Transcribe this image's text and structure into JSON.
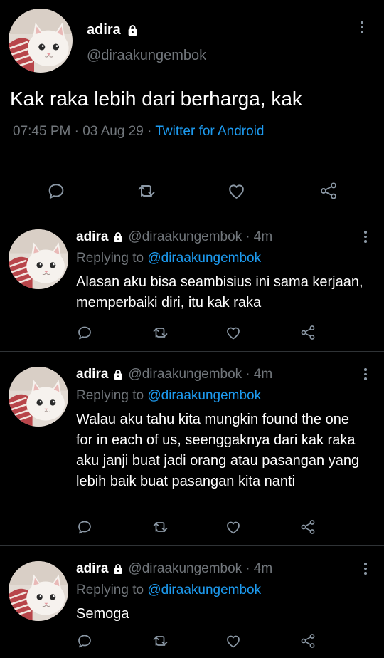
{
  "main_tweet": {
    "display_name": "adira",
    "handle": "@diraakungembok",
    "text": "Kak raka lebih dari berharga, kak",
    "time": "07:45 PM",
    "date": "03 Aug 29",
    "separator": "·",
    "source": "Twitter for Android"
  },
  "replies": [
    {
      "display_name": "adira",
      "handle": "@diraakungembok",
      "age": "· 4m",
      "replying_prefix": "Replying to ",
      "replying_handle": "@diraakungembok",
      "text": "Alasan aku bisa seambisius ini sama kerjaan, memperbaiki diri, itu kak raka"
    },
    {
      "display_name": "adira",
      "handle": "@diraakungembok",
      "age": "· 4m",
      "replying_prefix": "Replying to ",
      "replying_handle": "@diraakungembok",
      "text": "Walau aku tahu kita mungkin found the one for in each of us, seenggaknya dari kak raka aku janji buat jadi orang atau pasangan yang lebih baik buat pasangan kita nanti"
    },
    {
      "display_name": "adira",
      "handle": "@diraakungembok",
      "age": "· 4m",
      "replying_prefix": "Replying to ",
      "replying_handle": "@diraakungembok",
      "text": "Semoga"
    }
  ],
  "icons": [
    "lock-icon",
    "more-options-icon",
    "reply-icon",
    "retweet-icon",
    "like-icon",
    "share-icon"
  ],
  "colors": {
    "background": "#000000",
    "text": "#e7e9ea",
    "muted": "#71767b",
    "link": "#1d9bf0",
    "divider": "#2f3336"
  }
}
